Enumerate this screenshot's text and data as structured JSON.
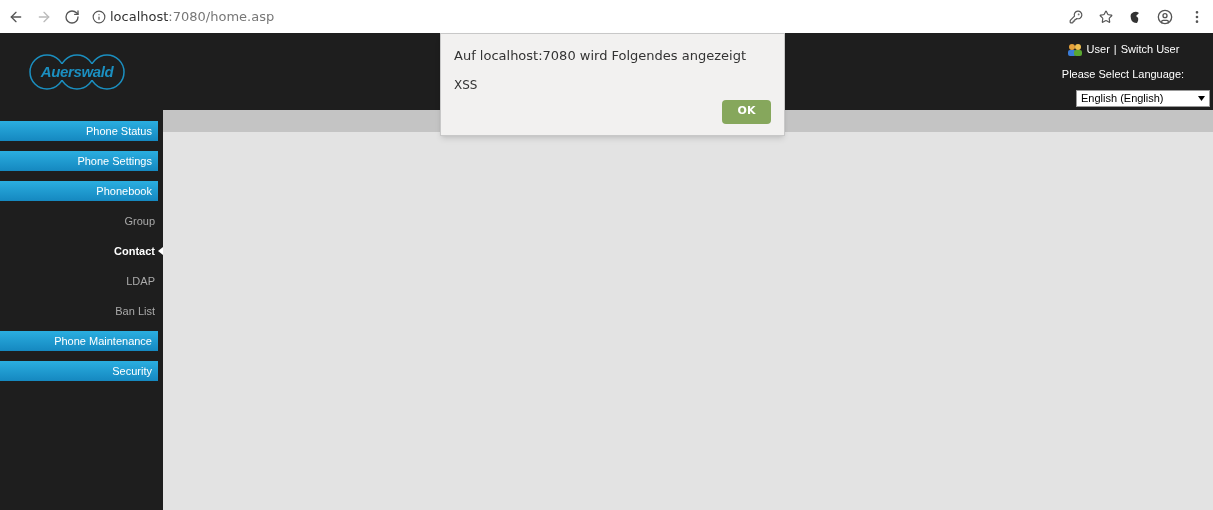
{
  "browser": {
    "url": "**localhost**:7080/home.asp"
  },
  "header": {
    "logo": "Auerswald",
    "user_link": "User",
    "switch_link": "Switch User",
    "separator": "|",
    "language_label": "Please Select Language:",
    "language_value": "English (English)"
  },
  "sidebar": {
    "items": [
      {
        "label": "Phone Status",
        "kind": "section",
        "selected": false
      },
      {
        "label": "Phone Settings",
        "kind": "section",
        "selected": false
      },
      {
        "label": "Phonebook",
        "kind": "section",
        "selected": false
      },
      {
        "label": "Group",
        "kind": "sub",
        "selected": false
      },
      {
        "label": "Contact",
        "kind": "sub",
        "selected": true
      },
      {
        "label": "LDAP",
        "kind": "sub",
        "selected": false
      },
      {
        "label": "Ban List",
        "kind": "sub",
        "selected": false
      },
      {
        "label": "Phone Maintenance",
        "kind": "section",
        "selected": false
      },
      {
        "label": "Security",
        "kind": "section",
        "selected": false
      }
    ]
  },
  "dialog": {
    "title": "Auf localhost:7080 wird Folgendes angezeigt",
    "message": "XSS",
    "button": "OK"
  }
}
